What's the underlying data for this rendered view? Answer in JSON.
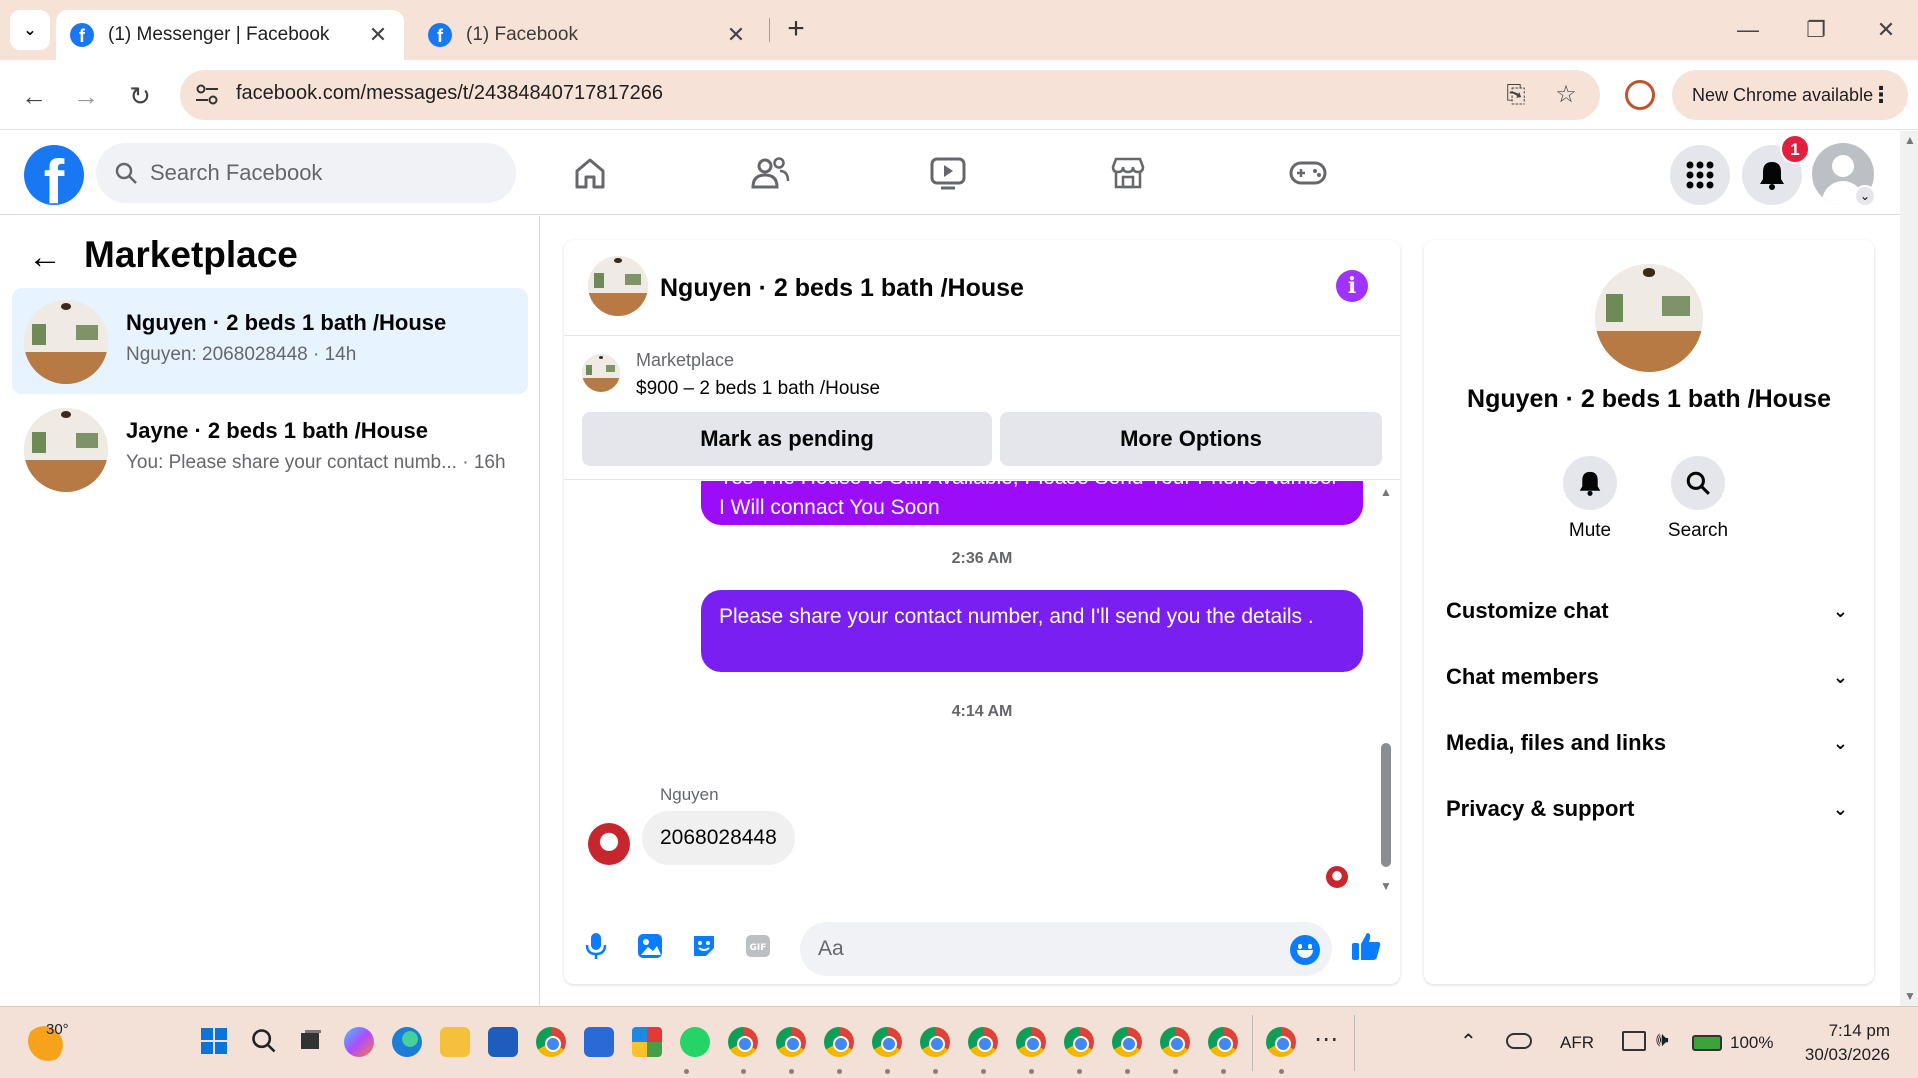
{
  "browser": {
    "tabs": [
      {
        "title": "(1) Messenger | Facebook",
        "active": true
      },
      {
        "title": "(1) Facebook",
        "active": false
      }
    ],
    "url": "facebook.com/messages/t/24384840717817266",
    "update_label": "New Chrome available"
  },
  "fb_header": {
    "search_placeholder": "Search Facebook",
    "notification_count": "1"
  },
  "left_panel": {
    "title": "Marketplace",
    "conversations": [
      {
        "name": "Nguyen · 2 beds 1 bath /House",
        "last_message": "Nguyen: 2068028448 · 14h",
        "active": true
      },
      {
        "name": "Jayne · 2 beds 1 bath /House",
        "last_message": "You: Please share your contact numb... · 16h",
        "active": false
      }
    ]
  },
  "chat": {
    "title": "Nguyen · 2 beds 1 bath /House",
    "marketplace_label": "Marketplace",
    "listing": "$900 – 2 beds 1 bath /House",
    "buttons": {
      "pending": "Mark as pending",
      "more": "More Options"
    },
    "messages": [
      {
        "from": "me",
        "text": "Yes The House Is Still Available, Please Send Your Phone Number I Will connact You Soon"
      },
      {
        "timestamp": "2:36 AM"
      },
      {
        "from": "me",
        "text": "Please share your contact number, and I'll send you the details ."
      },
      {
        "timestamp": "4:14 AM"
      },
      {
        "from": "Nguyen",
        "sender_label": "Nguyen",
        "text": "2068028448"
      }
    ],
    "composer_placeholder": "Aa",
    "accent_color": "#0a7cff",
    "bubble_color": "#7a1ff2"
  },
  "info_panel": {
    "name": "Nguyen · 2 beds 1 bath /House",
    "actions": [
      {
        "label": "Mute",
        "icon": "bell-icon"
      },
      {
        "label": "Search",
        "icon": "search-icon"
      }
    ],
    "sections": [
      "Customize chat",
      "Chat members",
      "Media, files and links",
      "Privacy & support"
    ]
  },
  "taskbar": {
    "temperature": "30°",
    "language": "AFR",
    "battery": "100%",
    "time": "7:14 pm",
    "date": "30/03/2026"
  }
}
